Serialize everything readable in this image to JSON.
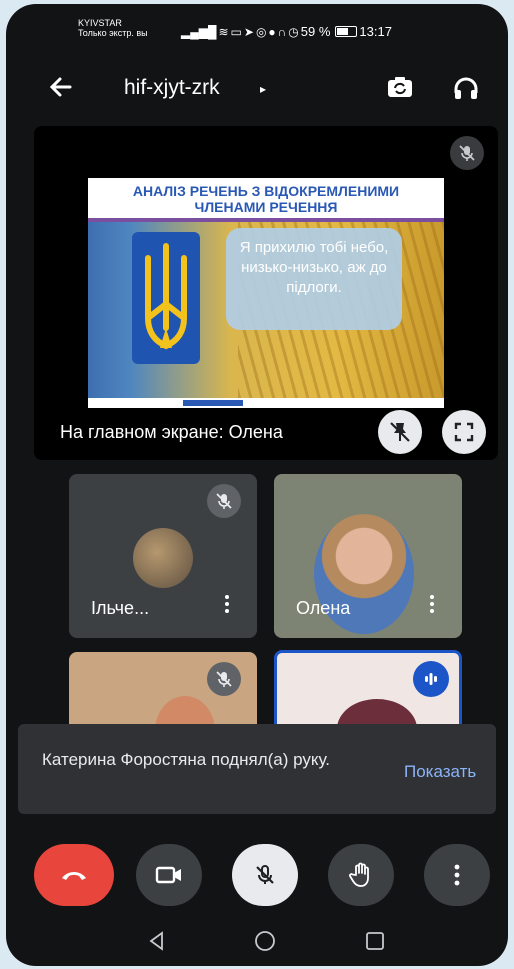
{
  "status_bar": {
    "carrier_name": "KYIVSTAR",
    "carrier_sub": "Только экстр. вы",
    "battery": "59 %",
    "battery_level": 0.59,
    "time": "13:17"
  },
  "app_bar": {
    "meeting_code": "hif-xjyt-zrk",
    "caret": "▸"
  },
  "stage": {
    "slide_title_line1": "АНАЛІЗ РЕЧЕНЬ З ВІДОКРЕМЛЕНИМИ",
    "slide_title_line2": "ЧЛЕНАМИ РЕЧЕННЯ",
    "slide_quote": "Я прихилю тобі небо, низько-низько, аж до підлоги.",
    "caption": "На главном экране: Олена"
  },
  "tiles": [
    {
      "name": "Ільче...",
      "muted": true
    },
    {
      "name": "Олена",
      "muted": false
    },
    {
      "name": "",
      "muted": true
    },
    {
      "name": "",
      "speaking": true
    }
  ],
  "toast": {
    "message": "Катерина Форостяна поднял(а) руку.",
    "action": "Показать"
  },
  "colors": {
    "background": "#121314",
    "end_call": "#e8453c",
    "accent_blue": "#1b55c8",
    "link": "#8ab4f8"
  }
}
